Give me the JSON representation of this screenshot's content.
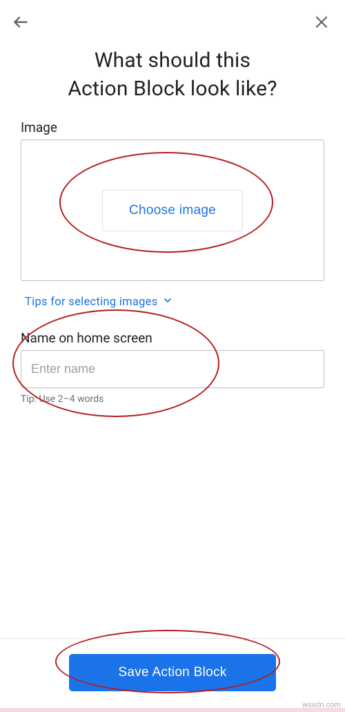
{
  "header": {
    "title_line1": "What should this",
    "title_line2": "Action Block look like?"
  },
  "image_section": {
    "label": "Image",
    "choose_button": "Choose image",
    "tips_label": "Tips for selecting images"
  },
  "name_section": {
    "label": "Name on home screen",
    "placeholder": "Enter name",
    "tip": "Tip: Use 2–4 words"
  },
  "footer": {
    "save_button": "Save Action Block"
  },
  "watermark": "wsxdn.com"
}
